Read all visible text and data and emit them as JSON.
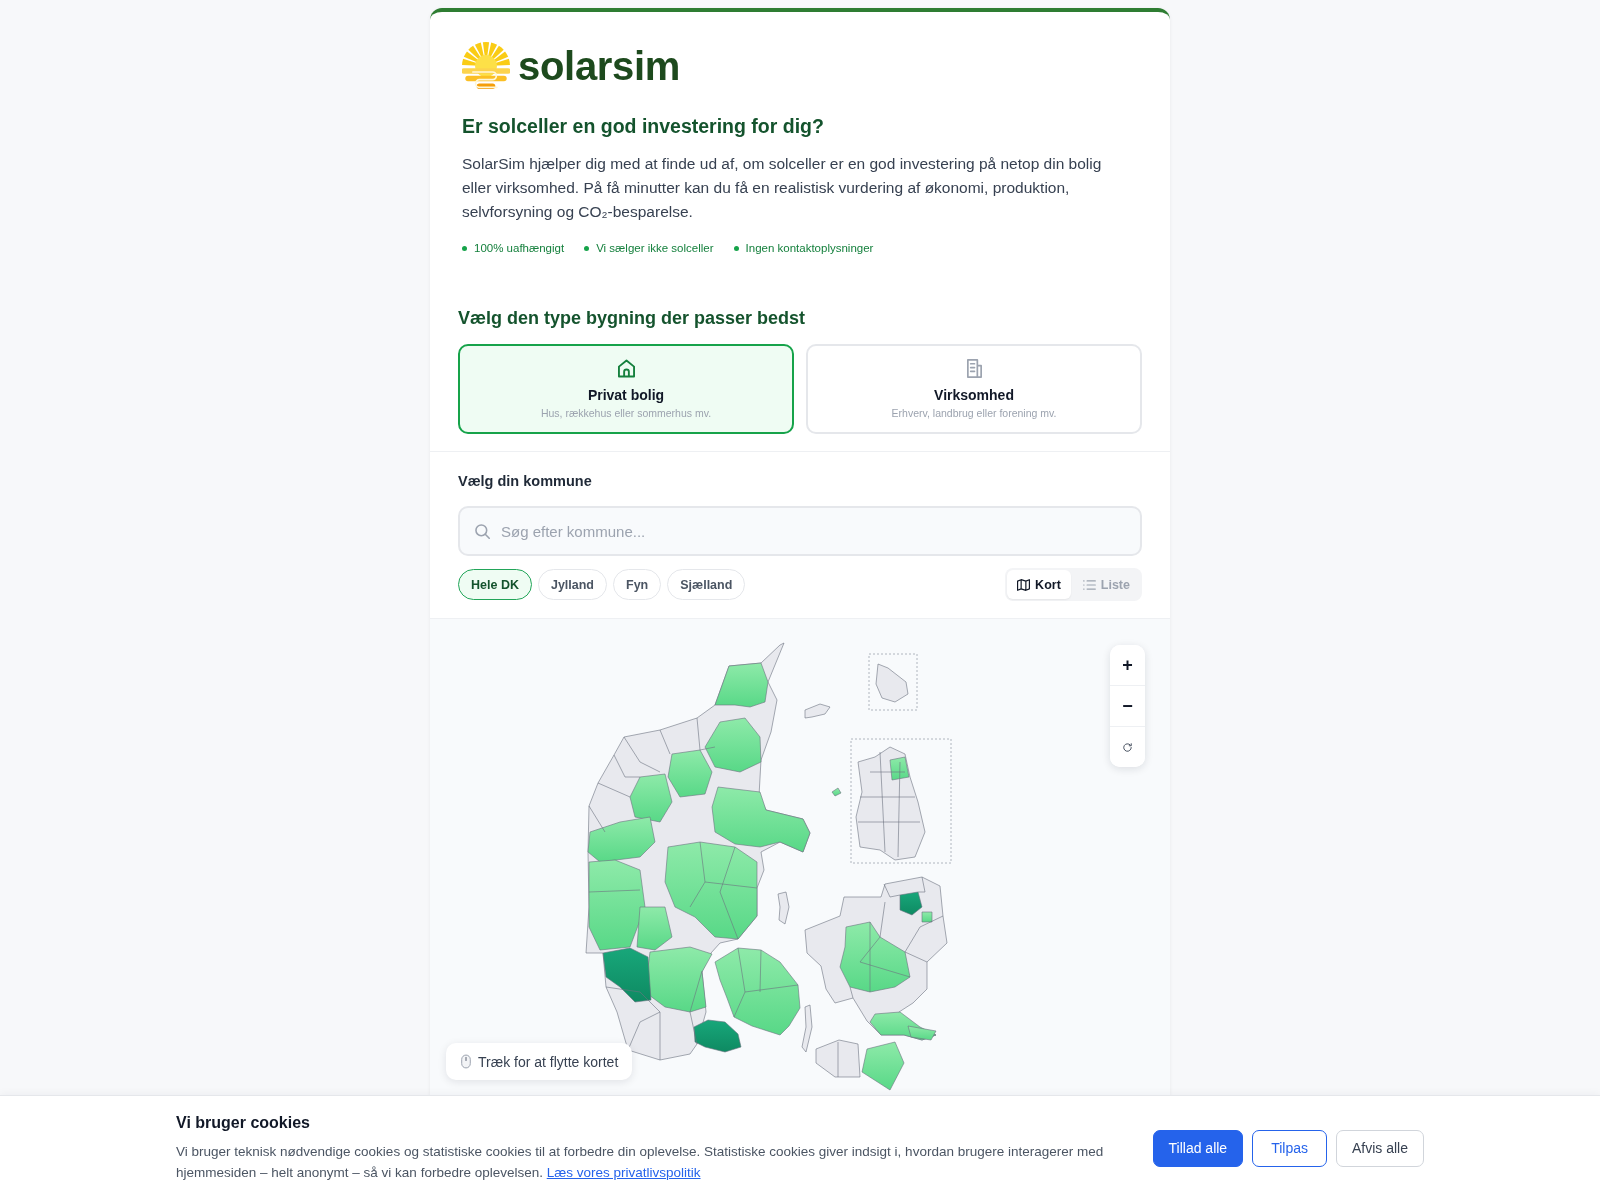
{
  "logo": {
    "text": "solarsim"
  },
  "intro": {
    "title": "Er solceller en god investering for dig?",
    "text": "SolarSim hjælper dig med at finde ud af, om solceller er en god investering på netop din bolig eller virksomhed. På få minutter kan du få en realistisk vurdering af økonomi, produktion, selvforsyning og CO₂-besparelse.",
    "features": [
      "100% uafhængigt",
      "Vi sælger ikke solceller",
      "Ingen kontaktoplysninger"
    ]
  },
  "building_type": {
    "heading": "Vælg den type bygning der passer bedst",
    "options": [
      {
        "kind": "house",
        "label": "Privat bolig",
        "description": "Hus, rækkehus eller sommerhus mv.",
        "selected": true
      },
      {
        "kind": "building",
        "label": "Virksomhed",
        "description": "Erhverv, landbrug eller forening mv.",
        "selected": false
      }
    ]
  },
  "municipality": {
    "heading": "Vælg din kommune",
    "search": {
      "placeholder": "Søg efter kommune..."
    },
    "regions": [
      {
        "label": "Hele DK",
        "selected": true
      },
      {
        "label": "Jylland",
        "selected": false
      },
      {
        "label": "Fyn",
        "selected": false
      },
      {
        "label": "Sjælland",
        "selected": false
      }
    ],
    "views": [
      {
        "kind": "map",
        "label": "Kort",
        "selected": true
      },
      {
        "kind": "list",
        "label": "Liste",
        "selected": false
      }
    ]
  },
  "map": {
    "controls": [
      {
        "kind": "zoom_in",
        "label": "+"
      },
      {
        "kind": "zoom_out",
        "label": "−"
      },
      {
        "kind": "reset"
      }
    ],
    "hint": "Træk for at flytte kortet"
  },
  "cookie_banner": {
    "title": "Vi bruger cookies",
    "text": "Vi bruger teknisk nødvendige cookies og statistiske cookies til at forbedre din oplevelse. Statistiske cookies giver indsigt i, hvordan brugere interagerer med hjemmesiden – helt anonymt – så vi kan forbedre oplevelsen.",
    "link": "Læs vores privatlivspolitik",
    "buttons": [
      {
        "kind": "accept",
        "label": "Tillad alle"
      },
      {
        "kind": "customize",
        "label": "Tilpas"
      },
      {
        "kind": "reject",
        "label": "Afvis alle"
      }
    ]
  }
}
